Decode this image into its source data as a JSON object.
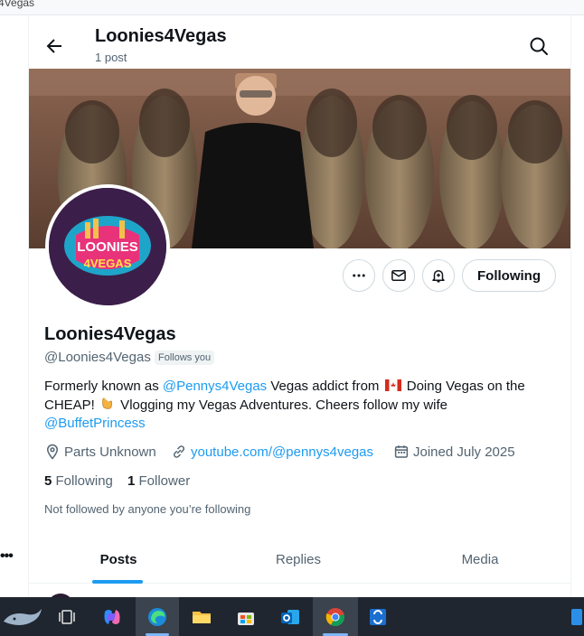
{
  "browser": {
    "tab_fragment": "4Vegas"
  },
  "header": {
    "title": "Loonies4Vegas",
    "subtitle": "1 post"
  },
  "avatar": {
    "logo_top": "LOONIES",
    "logo_bottom": "4VEGAS"
  },
  "actions": {
    "follow_label": "Following"
  },
  "profile": {
    "name": "Loonies4Vegas",
    "handle": "@Loonies4Vegas",
    "follows_you": "Follows you"
  },
  "bio": {
    "part1": "Formerly known as ",
    "mention1": "@Pennys4Vegas",
    "part2": " Vegas addict from ",
    "part3": " Doing Vegas on the CHEAP! ",
    "part4": " Vlogging my Vegas Adventures. Cheers follow my wife ",
    "mention2": "@BuffetPrincess"
  },
  "meta": {
    "location": "Parts Unknown",
    "website": "youtube.com/@pennys4vegas",
    "joined": "Joined July 2025"
  },
  "counts": {
    "following_num": "5",
    "following_label": "Following",
    "followers_num": "1",
    "followers_label": "Follower"
  },
  "not_followed": "Not followed by anyone you’re following",
  "tabs": [
    {
      "label": "Posts",
      "active": true
    },
    {
      "label": "Replies",
      "active": false
    },
    {
      "label": "Media",
      "active": false
    }
  ],
  "colors": {
    "accent": "#1d9bf0",
    "text": "#0f1419",
    "muted": "#536471"
  },
  "taskbar": {
    "icons": [
      "whale-icon",
      "task-view-icon",
      "copilot-icon",
      "edge-icon",
      "file-explorer-icon",
      "store-icon",
      "outlook-icon",
      "chrome-icon",
      "remote-app-icon",
      "widget-icon"
    ]
  }
}
